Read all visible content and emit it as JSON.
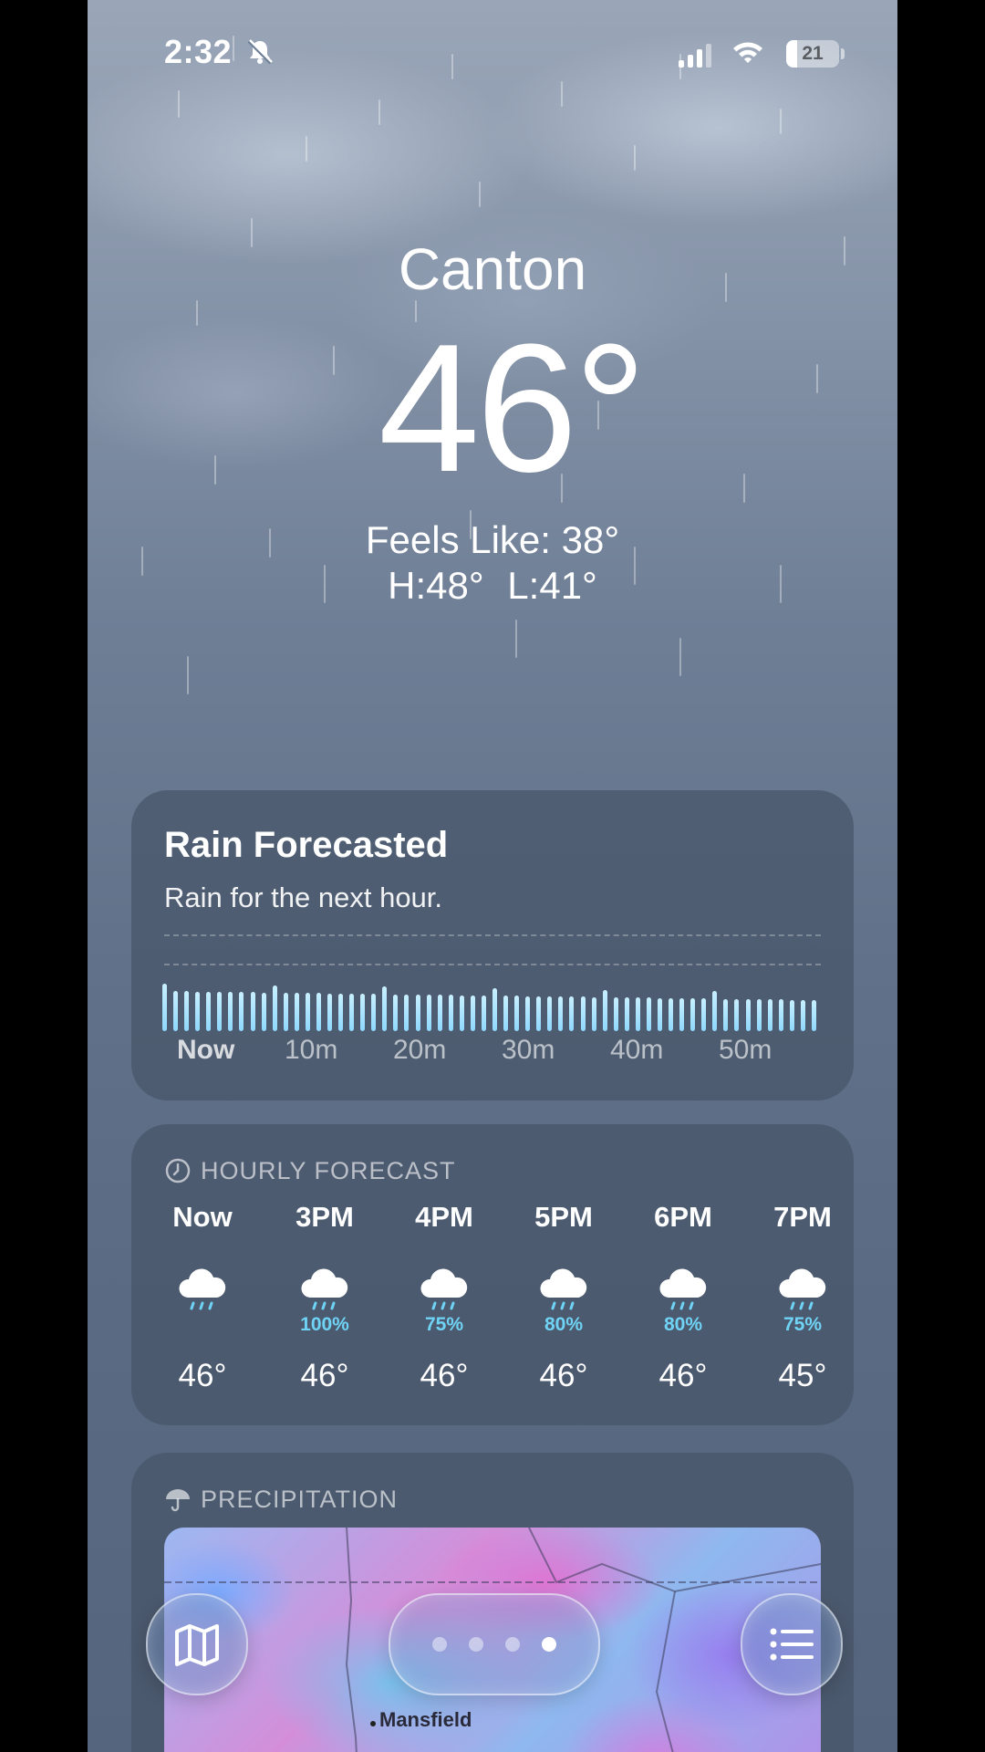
{
  "status_bar": {
    "time": "2:32",
    "battery": "21",
    "battery_level": 0.21
  },
  "header": {
    "city": "Canton",
    "temperature": "46°",
    "feels_like": "Feels Like: 38°",
    "high_low": "H:48° L:41°"
  },
  "rain_card": {
    "title": "Rain Forecasted",
    "subtitle": "Rain for the next hour.",
    "ticks": [
      "Now",
      "10m",
      "20m",
      "30m",
      "40m",
      "50m"
    ]
  },
  "hourly": {
    "title": "HOURLY FORECAST",
    "hours": [
      {
        "label": "Now",
        "pct": "",
        "temp": "46°"
      },
      {
        "label": "3PM",
        "pct": "100%",
        "temp": "46°"
      },
      {
        "label": "4PM",
        "pct": "75%",
        "temp": "46°"
      },
      {
        "label": "5PM",
        "pct": "80%",
        "temp": "46°"
      },
      {
        "label": "6PM",
        "pct": "80%",
        "temp": "46°"
      },
      {
        "label": "7PM",
        "pct": "75%",
        "temp": "45°"
      }
    ]
  },
  "precipitation": {
    "title": "PRECIPITATION",
    "map_city": "Mansfield"
  },
  "pager": {
    "pages": 4,
    "active_page": 4
  },
  "colors": {
    "precip_text": "#6fd3f5",
    "rain_bar": "#a9e4ff"
  },
  "icons": [
    "bell-slash-icon",
    "cellular-signal-icon",
    "wifi-icon",
    "battery-icon",
    "clock-icon",
    "rain-cloud-icon",
    "umbrella-icon",
    "map-icon",
    "list-icon"
  ]
}
